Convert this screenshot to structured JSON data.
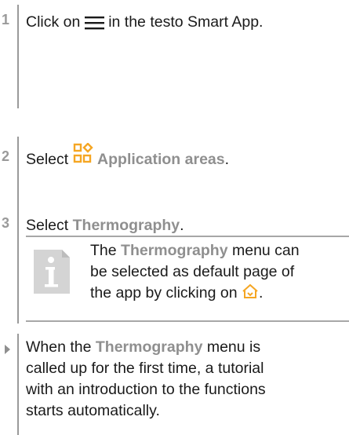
{
  "steps": [
    {
      "number": "1",
      "before": "Click on ",
      "icon": "hamburger-menu-icon",
      "after": " in the testo Smart App."
    },
    {
      "number": "2",
      "before": "Select ",
      "icon": "application-areas-icon",
      "bold": "Application areas",
      "after": "."
    },
    {
      "number": "3",
      "before": "Select ",
      "bold": "Thermography",
      "after": "."
    }
  ],
  "note": {
    "icon": "info-icon",
    "line1_before": "The ",
    "line1_bold": "Thermography",
    "line1_after": " menu can",
    "line2": "be selected as default page of",
    "line3": "the app by clicking on ",
    "line3_icon": "home-icon",
    "line3_after": "."
  },
  "result": {
    "icon": "result-arrow-icon",
    "line1_before": "When the ",
    "line1_bold": "Thermography",
    "line1_after": " menu is",
    "line2": "called up for the first time, a tutorial",
    "line3": "with an introduction to the functions",
    "line4": "starts automatically."
  },
  "colors": {
    "accent_grey": "#8f8f8f",
    "icon_orange": "#f5a623",
    "line_grey": "#9a9a9a"
  }
}
